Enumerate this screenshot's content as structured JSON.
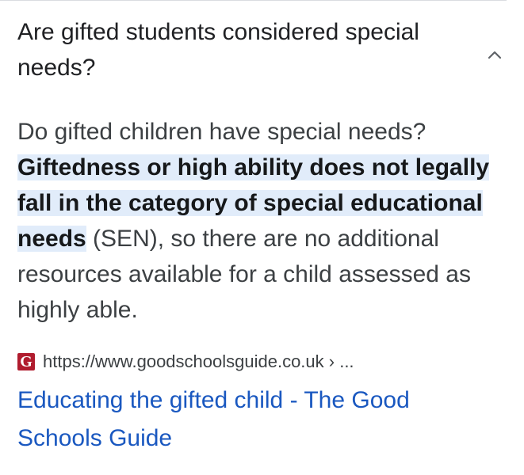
{
  "faq": {
    "question": "Are gifted students considered special needs?",
    "expand_icon": "chevron-up-icon"
  },
  "answer": {
    "lead": "Do gifted children have special needs?",
    "highlight": "Giftedness or high ability does not legally fall in the category of special educational needs",
    "rest": " (SEN), so there are no additional resources available for a child assessed as highly able."
  },
  "source": {
    "favicon_letter": "G",
    "favicon_color": "#b01c2e",
    "url": "https://www.goodschoolsguide.co.uk › ..."
  },
  "result": {
    "title": "Educating the gifted child - The Good Schools Guide",
    "link_color": "#1a58c0"
  }
}
